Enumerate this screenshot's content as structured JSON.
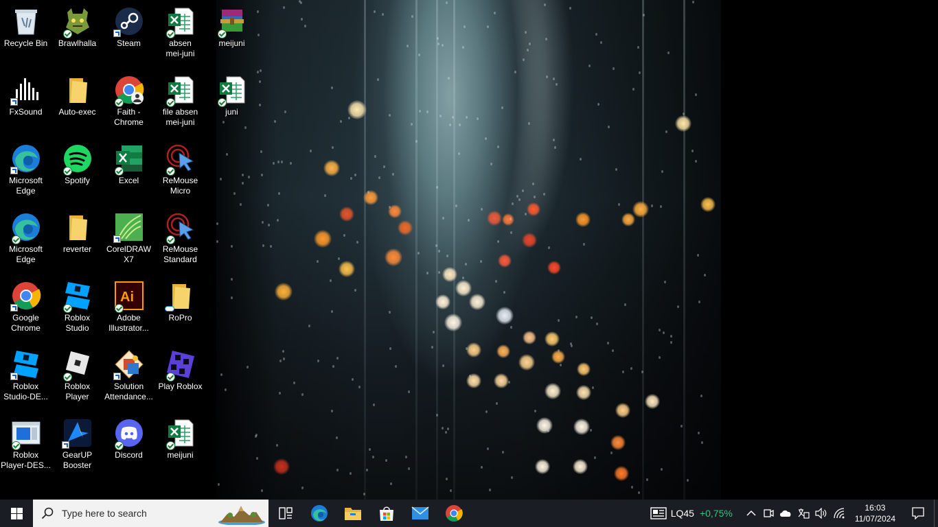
{
  "desktop": {
    "icons": [
      {
        "label": "Recycle Bin",
        "icon": "recycle-bin-icon"
      },
      {
        "label": "Brawlhalla",
        "icon": "brawlhalla-icon"
      },
      {
        "label": "Steam",
        "icon": "steam-icon"
      },
      {
        "label": "absen\nmei-juni",
        "icon": "excel-file-icon"
      },
      {
        "label": "meijuni",
        "icon": "winrar-archive-icon"
      },
      {
        "label": "FxSound",
        "icon": "fxsound-icon"
      },
      {
        "label": "Auto-exec",
        "icon": "folder-icon"
      },
      {
        "label": "Faith -\nChrome",
        "icon": "chrome-profile-icon"
      },
      {
        "label": "file absen\nmei-juni",
        "icon": "excel-file-icon"
      },
      {
        "label": "juni",
        "icon": "excel-file-icon"
      },
      {
        "label": "Microsoft\nEdge",
        "icon": "edge-icon"
      },
      {
        "label": "Spotify",
        "icon": "spotify-icon"
      },
      {
        "label": "Excel",
        "icon": "excel-app-icon"
      },
      {
        "label": "ReMouse\nMicro",
        "icon": "remouse-icon"
      },
      {
        "label": "Microsoft\nEdge",
        "icon": "edge-icon"
      },
      {
        "label": "reverter",
        "icon": "folder-icon"
      },
      {
        "label": "CorelDRAW\nX7",
        "icon": "coreldraw-icon"
      },
      {
        "label": "ReMouse\nStandard",
        "icon": "remouse-icon"
      },
      {
        "label": "Google\nChrome",
        "icon": "chrome-icon"
      },
      {
        "label": "Roblox\nStudio",
        "icon": "roblox-studio-icon"
      },
      {
        "label": "Adobe\nIllustrator...",
        "icon": "illustrator-icon"
      },
      {
        "label": "RoPro",
        "icon": "folder-icon"
      },
      {
        "label": "Roblox\nStudio-DE...",
        "icon": "roblox-studio-icon"
      },
      {
        "label": "Roblox\nPlayer",
        "icon": "roblox-player-icon"
      },
      {
        "label": "Solution\nAttendance...",
        "icon": "solution-attendance-icon"
      },
      {
        "label": "Play Roblox",
        "icon": "play-roblox-icon"
      },
      {
        "label": "Roblox\nPlayer-DES...",
        "icon": "roblox-player-window-icon"
      },
      {
        "label": "GearUP\nBooster",
        "icon": "gearup-icon"
      },
      {
        "label": "Discord",
        "icon": "discord-icon"
      },
      {
        "label": "meijuni",
        "icon": "excel-file-icon"
      }
    ]
  },
  "taskbar": {
    "search_placeholder": "Type here to search",
    "pinned": [
      "task-view-icon",
      "edge-icon",
      "file-explorer-icon",
      "microsoft-store-icon",
      "mail-icon",
      "chrome-icon"
    ],
    "stock": {
      "name": "LQ45",
      "change": "+0,75%"
    },
    "clock": {
      "time": "16:03",
      "date": "11/07/2024"
    }
  },
  "colors": {
    "taskbar_bg": "#1a1d24",
    "stock_up": "#3ac17a",
    "search_bg": "#f2f2f2"
  }
}
